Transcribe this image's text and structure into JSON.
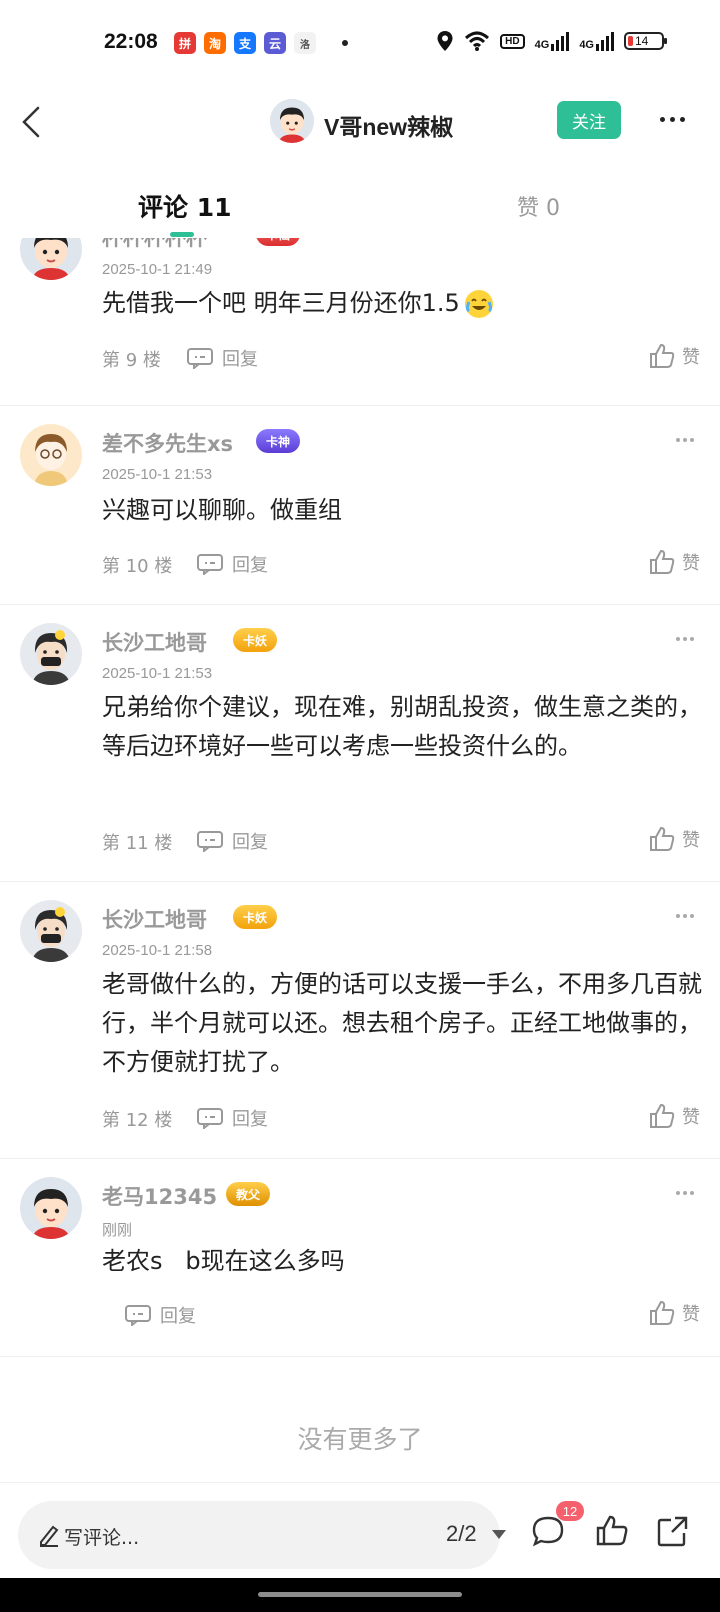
{
  "status_bar": {
    "time": "22:08",
    "app_icons": [
      "拼",
      "淘",
      "支",
      "云",
      "洛"
    ],
    "hd_label": "HD",
    "network_1": "4G",
    "network_2": "4G",
    "battery": "14",
    "icons": [
      "location-icon",
      "wifi-icon",
      "signal-icon",
      "battery-icon"
    ]
  },
  "header": {
    "title": "V哥new辣椒",
    "follow_label": "关注"
  },
  "tabs": {
    "comments_label": "评论 11",
    "likes_label": "赞 0"
  },
  "colors": {
    "accent": "#2fbf96",
    "badge_red": "#f4606c",
    "muted_text": "#999999"
  },
  "comments": [
    {
      "username": "杯杯杯杯杯",
      "badge": "卡仙",
      "time": "2025-10-1 21:49",
      "text": "先借我一个吧 明年三月份还你1.5",
      "floor": "第 9 楼",
      "reply": "回复",
      "like": "赞"
    },
    {
      "username": "差不多先生xs",
      "badge": "卡神",
      "time": "2025-10-1 21:53",
      "text": "兴趣可以聊聊。做重组",
      "floor": "第 10 楼",
      "reply": "回复",
      "like": "赞"
    },
    {
      "username": "长沙工地哥",
      "badge": "卡妖",
      "time": "2025-10-1 21:53",
      "text": "兄弟给你个建议，现在难，别胡乱投资，做生意之类的，等后边环境好一些可以考虑一些投资什么的。",
      "floor": "第 11 楼",
      "reply": "回复",
      "like": "赞"
    },
    {
      "username": "长沙工地哥",
      "badge": "卡妖",
      "time": "2025-10-1 21:58",
      "text": "老哥做什么的，方便的话可以支援一手么，不用多几百就行，半个月就可以还。想去租个房子。正经工地做事的，不方便就打扰了。",
      "floor": "第 12 楼",
      "reply": "回复",
      "like": "赞"
    },
    {
      "username": "老马12345",
      "badge": "教父",
      "time": "刚刚",
      "text": "老农s   b现在这么多吗",
      "floor": "",
      "reply": "回复",
      "like": "赞"
    }
  ],
  "no_more": "没有更多了",
  "bottom_bar": {
    "input_placeholder": "写评论...",
    "page_indicator": "2/2",
    "comment_count_badge": "12"
  }
}
